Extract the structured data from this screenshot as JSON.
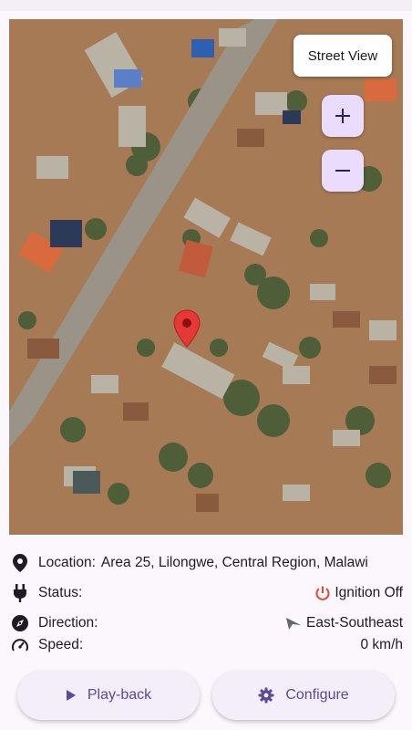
{
  "map": {
    "street_view_label": "Street View",
    "zoom_in_label": "+",
    "zoom_out_label": "−",
    "icons": {
      "marker": "map-pin-icon",
      "zoom_in": "plus-icon",
      "zoom_out": "minus-icon"
    }
  },
  "details": {
    "location": {
      "label": "Location:",
      "value": "Area 25, Lilongwe, Central Region, Malawi",
      "icon": "location-pin-icon"
    },
    "status": {
      "label": "Status:",
      "value": "Ignition Off",
      "icon": "plug-icon",
      "value_icon": "power-icon",
      "value_icon_color": "#e3492f"
    },
    "direction": {
      "label": "Direction:",
      "value": "East-Southeast",
      "icon": "compass-icon",
      "value_icon": "direction-arrow-icon",
      "value_icon_color": "#5d6b6b"
    },
    "speed": {
      "label": "Speed:",
      "value": "0 km/h",
      "icon": "speedometer-icon"
    }
  },
  "actions": {
    "playback_label": "Play-back",
    "configure_label": "Configure",
    "accent_color": "#5a4a9a"
  }
}
